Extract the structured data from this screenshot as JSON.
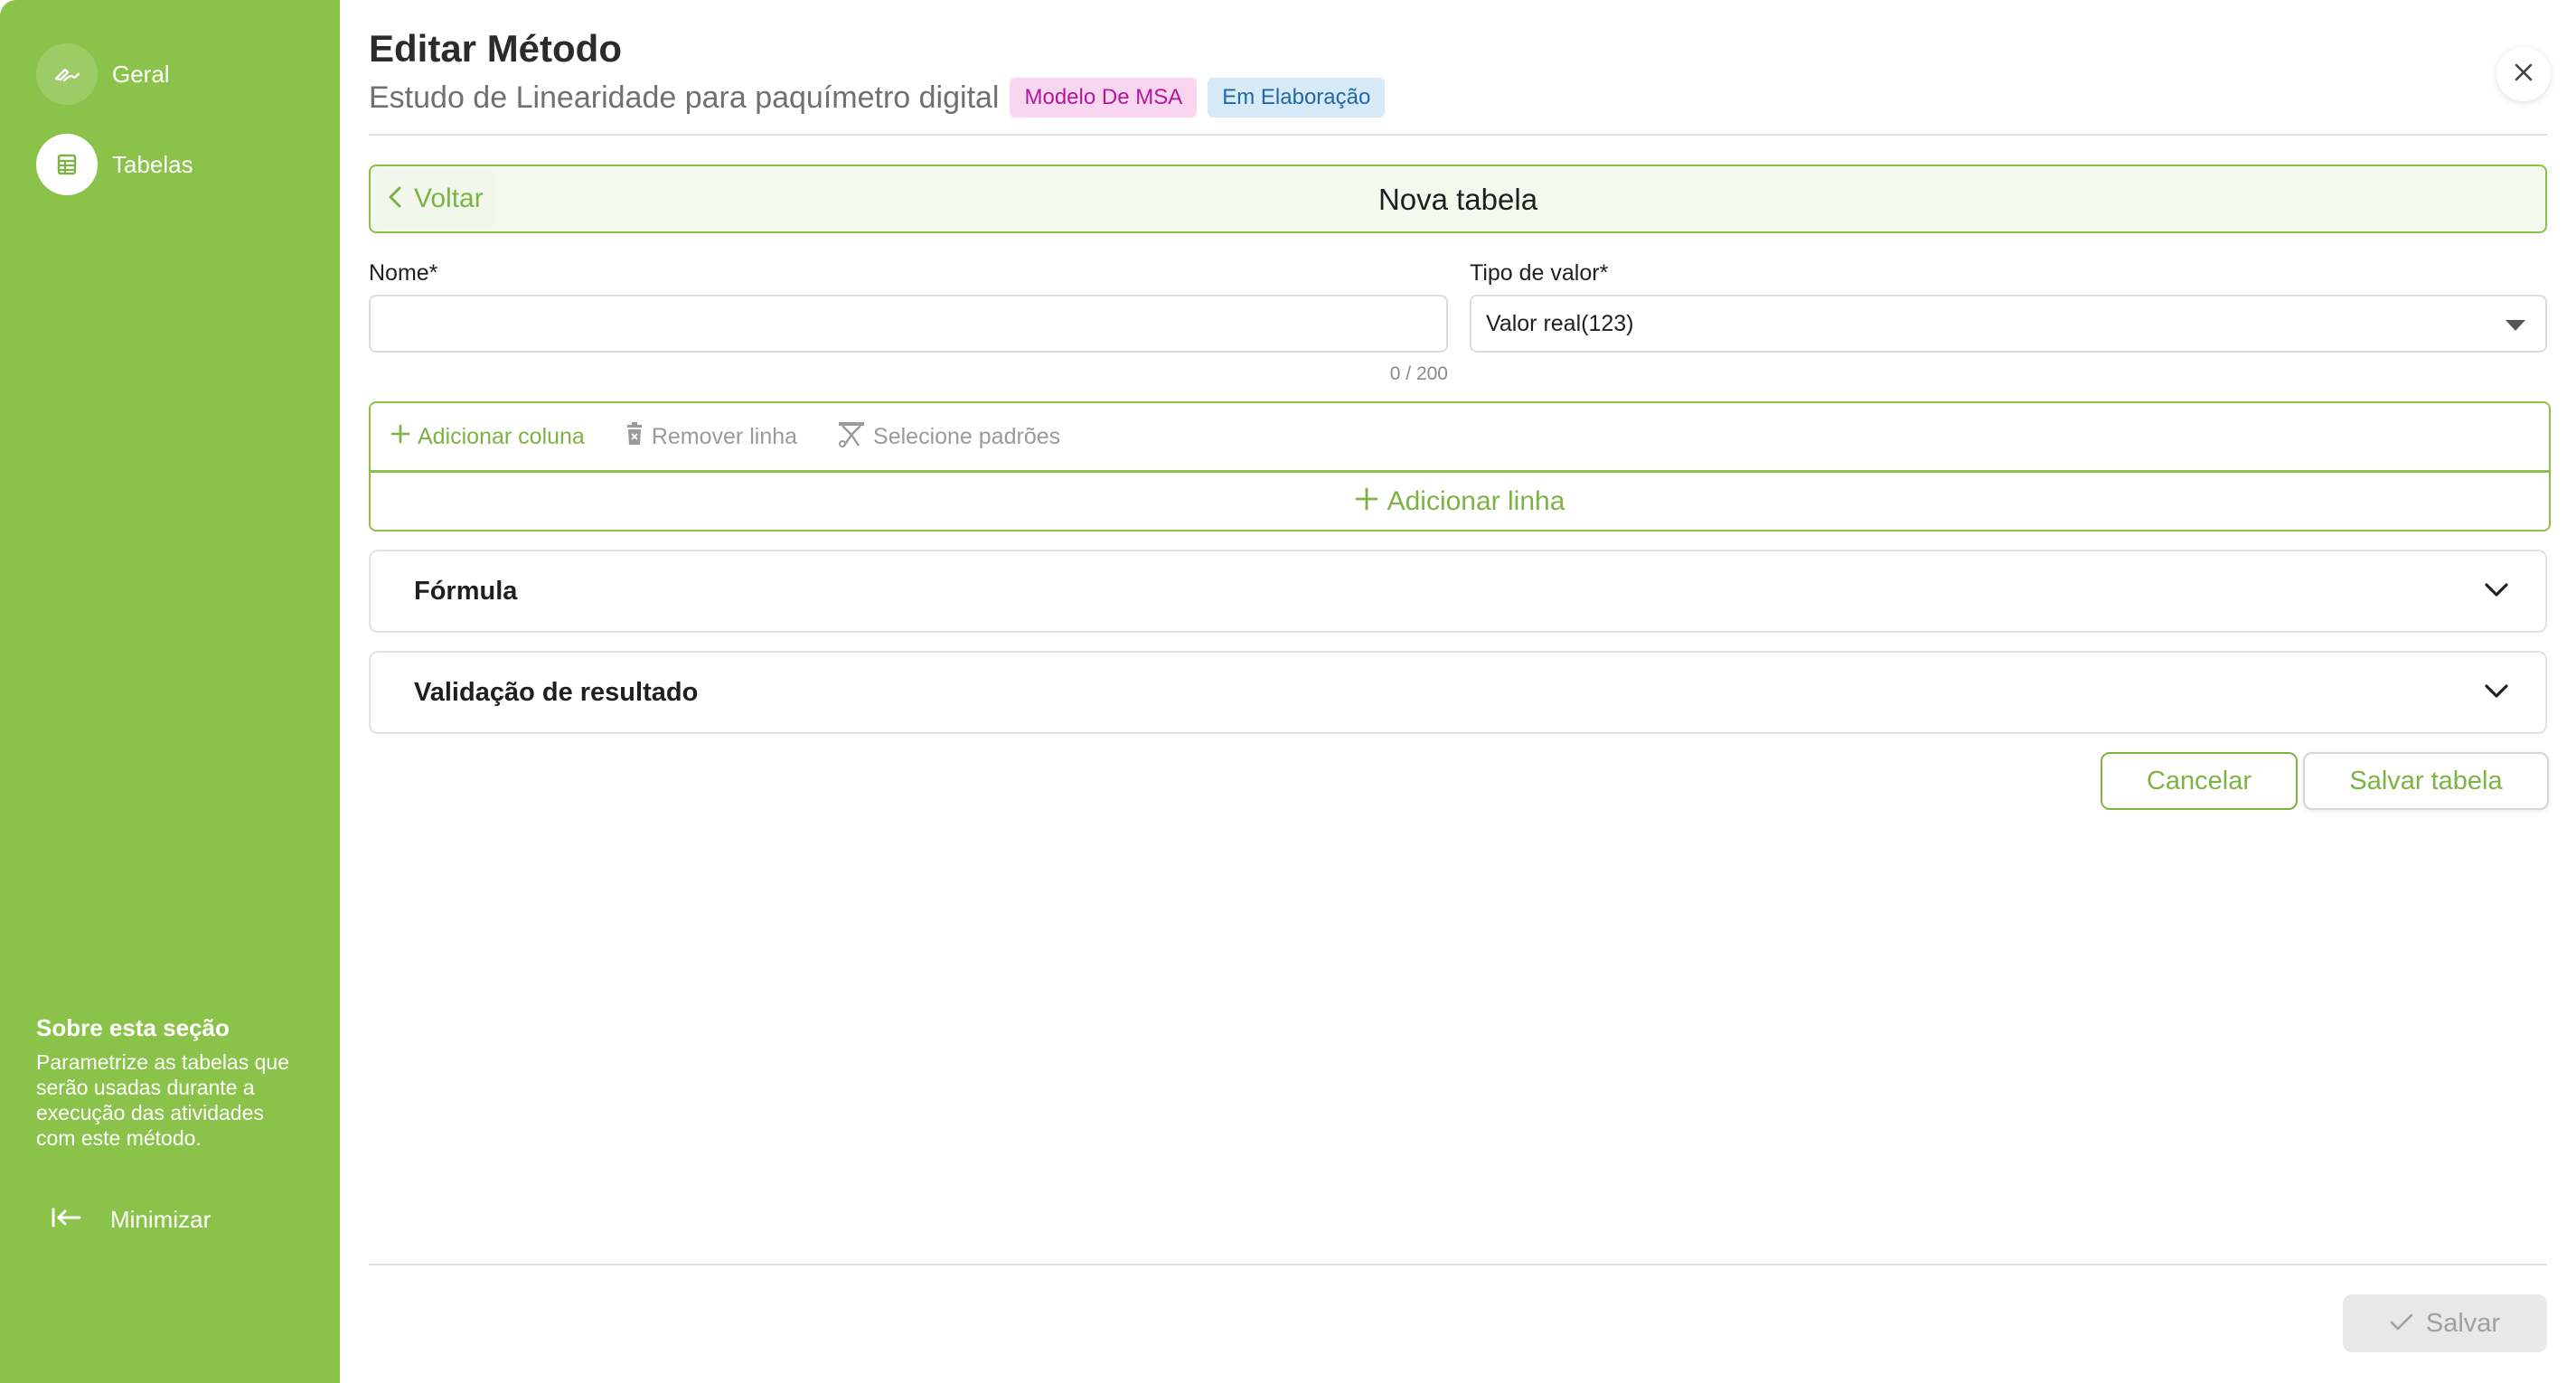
{
  "sidebar": {
    "items": [
      {
        "label": "Geral",
        "icon": "signature-icon",
        "active": false
      },
      {
        "label": "Tabelas",
        "icon": "table-icon",
        "active": true
      }
    ],
    "about": {
      "title": "Sobre esta seção",
      "text": "Parametrize as tabelas que serão usadas durante a execução das atividades com este método."
    },
    "minimize_label": "Minimizar"
  },
  "header": {
    "title": "Editar Método",
    "subtitle": "Estudo de Linearidade para paquímetro digital",
    "tags": [
      {
        "label": "Modelo De MSA",
        "bg": "#f9d6ef",
        "color": "#b3179b"
      },
      {
        "label": "Em Elaboração",
        "bg": "#d6eaf8",
        "color": "#2067a8"
      }
    ]
  },
  "back_bar": {
    "back_label": "Voltar",
    "title": "Nova tabela"
  },
  "form": {
    "name_label": "Nome*",
    "name_value": "",
    "name_counter": "0 / 200",
    "type_label": "Tipo de valor*",
    "type_value": "Valor real(123)"
  },
  "table_editor": {
    "add_column": "Adicionar coluna",
    "remove_row": "Remover linha",
    "select_standards": "Selecione padrões",
    "add_row": "Adicionar linha"
  },
  "sections": {
    "formula": "Fórmula",
    "validation": "Validação de resultado"
  },
  "actions": {
    "cancel": "Cancelar",
    "save_table": "Salvar tabela",
    "save": "Salvar"
  },
  "colors": {
    "sidebar": "#8bc34a",
    "accent": "#7cb342",
    "disabled_text": "#9a9a9a"
  }
}
